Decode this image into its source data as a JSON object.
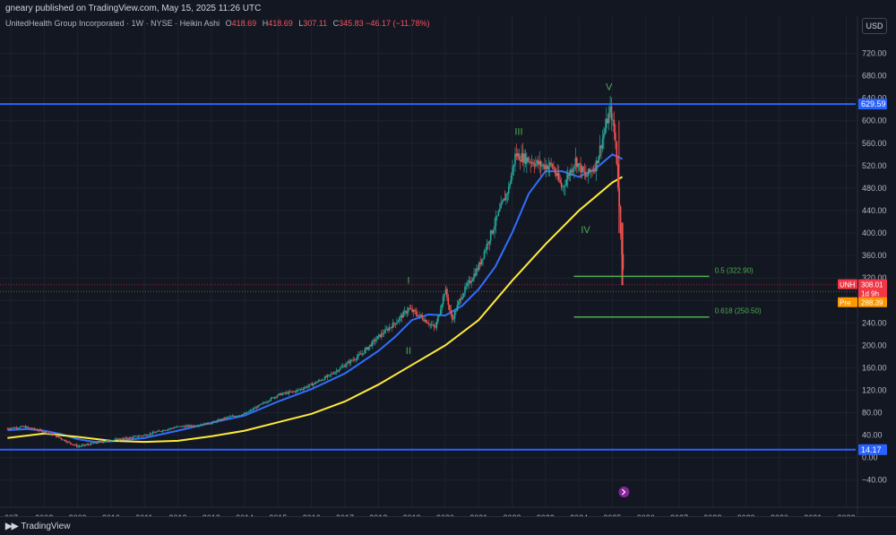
{
  "header": {
    "published_by": "gneary published on TradingView.com, May 15, 2025 11:26 UTC"
  },
  "legend": {
    "symbol": "UnitedHealth Group Incorporated · 1W · NYSE · Heikin Ashi",
    "open_label": "O",
    "open": "418.69",
    "high_label": "H",
    "high": "418.69",
    "low_label": "L",
    "low": "307.11",
    "close_label": "C",
    "close": "345.83",
    "change": "−46.17 (−11.78%)"
  },
  "currency_button": "USD",
  "footer": {
    "brand": "TradingView"
  },
  "colors": {
    "background": "#131722",
    "up": "#26a69a",
    "down": "#ef5350",
    "horizontal_line": "#2962ff",
    "ma_blue": "#2f6fff",
    "ma_yellow": "#ffeb3b",
    "fib": "#4caf50",
    "wave_label": "#4caf50",
    "price_tag": "#f23645",
    "premarket_tag": "#ff9800"
  },
  "chart_data": {
    "type": "line",
    "title": "",
    "xlabel": "",
    "ylabel": "",
    "ylim": [
      -50,
      740
    ],
    "x_ticks": [
      "007",
      "2008",
      "2009",
      "2010",
      "2011",
      "2012",
      "2013",
      "2014",
      "2015",
      "2016",
      "2017",
      "2018",
      "2019",
      "2020",
      "2021",
      "2022",
      "2023",
      "2024",
      "2025",
      "2026",
      "2027",
      "2028",
      "2029",
      "2030",
      "2031",
      "2032"
    ],
    "y_ticks": [
      "720.00",
      "680.00",
      "640.00",
      "600.00",
      "560.00",
      "520.00",
      "480.00",
      "440.00",
      "400.00",
      "360.00",
      "320.00",
      "280.00",
      "240.00",
      "200.00",
      "160.00",
      "120.00",
      "80.00",
      "40.00",
      "0.00",
      "−40.00"
    ],
    "y_tick_values": [
      720,
      680,
      640,
      600,
      560,
      520,
      480,
      440,
      400,
      360,
      320,
      280,
      240,
      200,
      160,
      120,
      80,
      40,
      0,
      -40
    ],
    "price_series": {
      "x": [
        2006.9,
        2007.4,
        2007.9,
        2008.3,
        2008.7,
        2009.0,
        2009.2,
        2009.6,
        2010.0,
        2010.5,
        2011.0,
        2011.5,
        2012.0,
        2012.5,
        2013.0,
        2013.5,
        2014.0,
        2014.5,
        2015.0,
        2015.5,
        2016.0,
        2016.5,
        2017.0,
        2017.5,
        2018.0,
        2018.5,
        2018.9,
        2019.3,
        2019.7,
        2020.0,
        2020.2,
        2020.5,
        2021.0,
        2021.5,
        2021.9,
        2022.1,
        2022.5,
        2022.9,
        2023.2,
        2023.5,
        2023.9,
        2024.2,
        2024.5,
        2024.8,
        2024.95,
        2025.1,
        2025.25,
        2025.35
      ],
      "y": [
        52,
        55,
        48,
        40,
        28,
        20,
        22,
        27,
        31,
        35,
        40,
        48,
        55,
        57,
        62,
        72,
        78,
        95,
        112,
        118,
        130,
        145,
        165,
        185,
        215,
        240,
        265,
        250,
        230,
        300,
        245,
        290,
        340,
        420,
        480,
        540,
        530,
        520,
        520,
        480,
        530,
        500,
        520,
        590,
        620,
        560,
        400,
        308
      ]
    },
    "series": [
      {
        "name": "",
        "color": "#2f6fff",
        "x": [
          2006.9,
          2007.5,
          2008.0,
          2008.5,
          2009.0,
          2009.5,
          2010.0,
          2011.0,
          2012.0,
          2013.0,
          2014.0,
          2015.0,
          2016.0,
          2017.0,
          2018.0,
          2018.5,
          2019.0,
          2019.5,
          2020.0,
          2020.5,
          2021.0,
          2021.5,
          2022.0,
          2022.5,
          2023.0,
          2023.5,
          2024.0,
          2024.5,
          2025.0,
          2025.3
        ],
        "y": [
          49,
          51,
          48,
          42,
          33,
          28,
          29,
          35,
          48,
          62,
          75,
          100,
          122,
          150,
          190,
          215,
          245,
          255,
          253,
          270,
          300,
          340,
          400,
          470,
          510,
          510,
          500,
          515,
          540,
          532
        ]
      },
      {
        "name": "",
        "color": "#ffeb3b",
        "x": [
          2006.9,
          2008.0,
          2009.0,
          2010.0,
          2011.0,
          2012.0,
          2013.0,
          2014.0,
          2015.0,
          2016.0,
          2017.0,
          2018.0,
          2019.0,
          2020.0,
          2021.0,
          2022.0,
          2023.0,
          2024.0,
          2024.5,
          2025.0,
          2025.3
        ],
        "y": [
          35,
          43,
          37,
          30,
          28,
          30,
          38,
          48,
          63,
          78,
          100,
          130,
          165,
          200,
          245,
          315,
          380,
          440,
          465,
          490,
          500
        ]
      }
    ],
    "horizontal_lines": [
      {
        "value": 629.59,
        "label": "629.59",
        "color": "#2962ff"
      },
      {
        "value": 14.17,
        "label": "14.17",
        "color": "#2962ff"
      }
    ],
    "fib_levels": [
      {
        "label": "0.5 (322.90)",
        "value": 322.9,
        "x_start": 2023.85,
        "x_end": 2027.9
      },
      {
        "label": "0.618 (250.50)",
        "value": 250.5,
        "x_start": 2023.85,
        "x_end": 2027.9
      }
    ],
    "wave_labels": [
      {
        "text": "I",
        "x": 2018.9,
        "y": 310
      },
      {
        "text": "II",
        "x": 2018.9,
        "y": 185
      },
      {
        "text": "III",
        "x": 2022.2,
        "y": 575
      },
      {
        "text": "IV",
        "x": 2024.2,
        "y": 400
      },
      {
        "text": "V",
        "x": 2024.9,
        "y": 655
      }
    ],
    "price_tags": [
      {
        "label": "UNH",
        "value": "308.01",
        "y": 308.01,
        "color": "#f23645"
      },
      {
        "label": "",
        "value": "1d 9h",
        "y": 292,
        "color": "#f23645"
      },
      {
        "label": "Pre",
        "value": "288.39",
        "y": 276,
        "color": "#ff9800"
      }
    ],
    "grid": true,
    "legend_placement": "top-left"
  }
}
